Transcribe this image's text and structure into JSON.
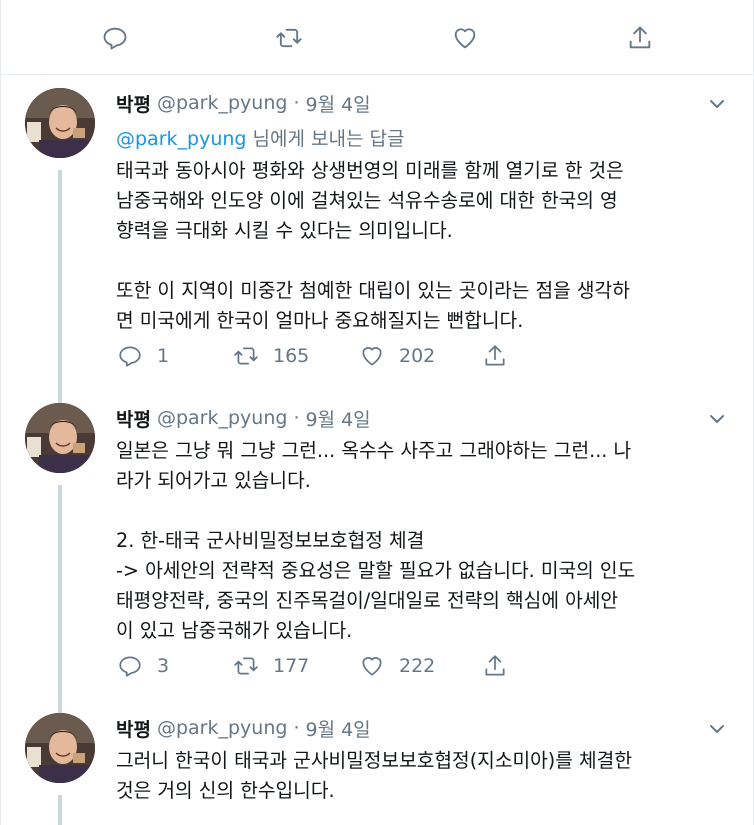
{
  "top_actions": {
    "reply_icon": "reply-icon",
    "retweet_icon": "retweet-icon",
    "like_icon": "heart-icon",
    "share_icon": "share-icon"
  },
  "tweets": [
    {
      "name": "박평",
      "handle": "@park_pyung",
      "separator": "·",
      "date": "9월 4일",
      "reply_to_prefix": "@park_pyung",
      "reply_to_suffix": " 님에게 보내는 답글",
      "text": "태국과 동아시아 평화와 상생번영의 미래를 함께 열기로 한 것은\n남중국해와 인도양 이에 걸쳐있는 석유수송로에 대한 한국의 영\n향력을 극대화 시킬 수 있다는 의미입니다.\n\n또한 이 지역이 미중간 첨예한 대립이 있는 곳이라는 점을 생각하\n면 미국에게 한국이 얼마나 중요해질지는 뻔합니다.",
      "replies": "1",
      "retweets": "165",
      "likes": "202"
    },
    {
      "name": "박평",
      "handle": "@park_pyung",
      "separator": "·",
      "date": "9월 4일",
      "text": "일본은 그냥 뭐 그냥 그런... 옥수수 사주고 그래야하는 그런... 나\n라가 되어가고 있습니다.\n\n2. 한-태국 군사비밀정보보호협정 체결\n-> 아세안의 전략적 중요성은 말할 필요가 없습니다. 미국의 인도\n태평양전략, 중국의 진주목걸이/일대일로 전략의 핵심에 아세안\n이 있고 남중국해가 있습니다.",
      "replies": "3",
      "retweets": "177",
      "likes": "222"
    },
    {
      "name": "박평",
      "handle": "@park_pyung",
      "separator": "·",
      "date": "9월 4일",
      "text": "그러니 한국이 태국과 군사비밀정보보호협정(지소미아)를 체결한\n것은 거의 신의 한수입니다."
    }
  ],
  "colors": {
    "accent": "#1b95e0",
    "muted": "#657786",
    "divider": "#e6ecf0",
    "thread": "#ccd6dd"
  }
}
